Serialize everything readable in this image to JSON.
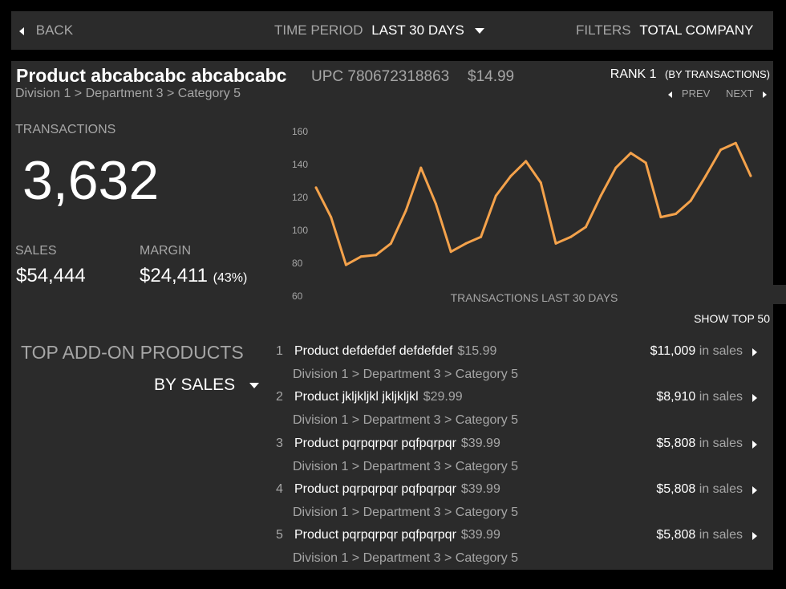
{
  "topbar": {
    "back_label": "BACK",
    "time_period_label": "TIME PERIOD",
    "time_period_value": "LAST 30 DAYS",
    "filters_label": "FILTERS",
    "filters_value": "TOTAL COMPANY"
  },
  "product": {
    "name": "Product abcabcabc abcabcabc",
    "upc": "UPC 780672318863",
    "price": "$14.99",
    "path": "Division 1 > Department 3 > Category 5",
    "rank_label": "RANK 1",
    "rank_basis": "(BY TRANSACTIONS)",
    "prev_label": "PREV",
    "next_label": "NEXT"
  },
  "metrics": {
    "transactions_label": "TRANSACTIONS",
    "transactions_value": "3,632",
    "sales_label": "SALES",
    "sales_value": "$54,444",
    "margin_label": "MARGIN",
    "margin_value": "$24,411",
    "margin_pct": "(43%)"
  },
  "chart_data": {
    "type": "line",
    "xlabel": "TRANSACTIONS  LAST 30 DAYS",
    "ylim": [
      60,
      160
    ],
    "yticks": [
      60,
      80,
      100,
      120,
      140,
      160
    ],
    "grid": false,
    "line_color": "#f4a24b",
    "x": [
      1,
      2,
      3,
      4,
      5,
      6,
      7,
      8,
      9,
      10,
      11,
      12,
      13,
      14,
      15,
      16,
      17,
      18,
      19,
      20,
      21,
      22,
      23,
      24,
      25,
      26,
      27,
      28,
      29,
      30
    ],
    "values": [
      126,
      108,
      79,
      84,
      85,
      92,
      112,
      138,
      116,
      87,
      92,
      96,
      121,
      133,
      142,
      129,
      92,
      96,
      102,
      121,
      138,
      147,
      141,
      108,
      110,
      118,
      133,
      149,
      153,
      133
    ]
  },
  "addons": {
    "show_top_label": "SHOW TOP 50",
    "title": "TOP ADD-ON PRODUCTS",
    "sort_label": "BY SALES",
    "sales_suffix": "in sales",
    "items": [
      {
        "rank": "1",
        "name": "Product defdefdef defdefdef",
        "price": "$15.99",
        "path": "Division 1 > Department 3 > Category 5",
        "sales": "$11,009"
      },
      {
        "rank": "2",
        "name": "Product jkljkljkl jkljkljkl",
        "price": "$29.99",
        "path": "Division 1 > Department 3 > Category 5",
        "sales": "$8,910"
      },
      {
        "rank": "3",
        "name": "Product pqrpqrpqr pqfpqrpqr",
        "price": "$39.99",
        "path": "Division 1 > Department 3 > Category 5",
        "sales": "$5,808"
      },
      {
        "rank": "4",
        "name": "Product pqrpqrpqr pqfpqrpqr",
        "price": "$39.99",
        "path": "Division 1 > Department 3 > Category 5",
        "sales": "$5,808"
      },
      {
        "rank": "5",
        "name": "Product pqrpqrpqr pqfpqrpqr",
        "price": "$39.99",
        "path": "Division 1 > Department 3 > Category 5",
        "sales": "$5,808"
      }
    ]
  }
}
